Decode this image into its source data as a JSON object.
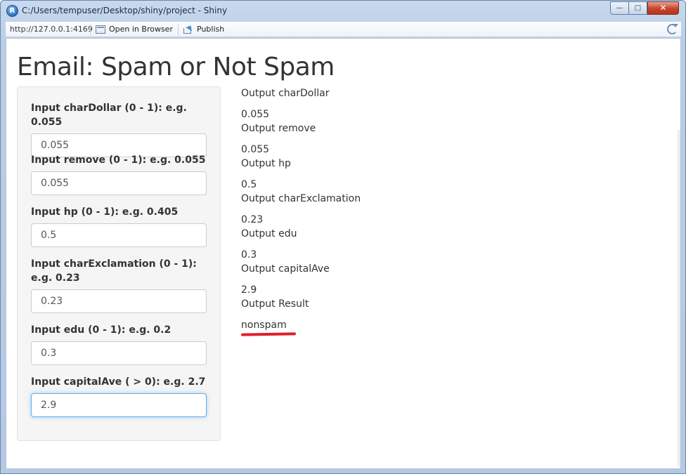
{
  "window": {
    "title": "C:/Users/tempuser/Desktop/shiny/project - Shiny"
  },
  "toolbar": {
    "url": "http://127.0.0.1:4169",
    "open_in_browser": "Open in Browser",
    "publish": "Publish"
  },
  "page": {
    "title": "Email: Spam or Not Spam"
  },
  "inputs": [
    {
      "label": "Input charDollar (0 - 1): e.g. 0.055",
      "value": "0.055"
    },
    {
      "label": "Input remove (0 - 1): e.g. 0.055",
      "value": "0.055"
    },
    {
      "label": "Input hp (0 - 1): e.g. 0.405",
      "value": "0.5"
    },
    {
      "label": "Input charExclamation (0 - 1): e.g. 0.23",
      "value": "0.23"
    },
    {
      "label": "Input edu (0 - 1): e.g. 0.2",
      "value": "0.3"
    },
    {
      "label": "Input capitalAve ( > 0): e.g. 2.7",
      "value": "2.9"
    }
  ],
  "outputs": [
    {
      "label": "Output charDollar",
      "value": "0.055"
    },
    {
      "label": "Output remove",
      "value": "0.055"
    },
    {
      "label": "Output hp",
      "value": "0.5"
    },
    {
      "label": "Output charExclamation",
      "value": "0.23"
    },
    {
      "label": "Output edu",
      "value": "0.3"
    },
    {
      "label": "Output capitalAve",
      "value": "2.9"
    },
    {
      "label": "Output Result",
      "value": "nonspam"
    }
  ],
  "colors": {
    "annotation_underline": "#e01f2a",
    "focus_border": "#66afe9"
  }
}
